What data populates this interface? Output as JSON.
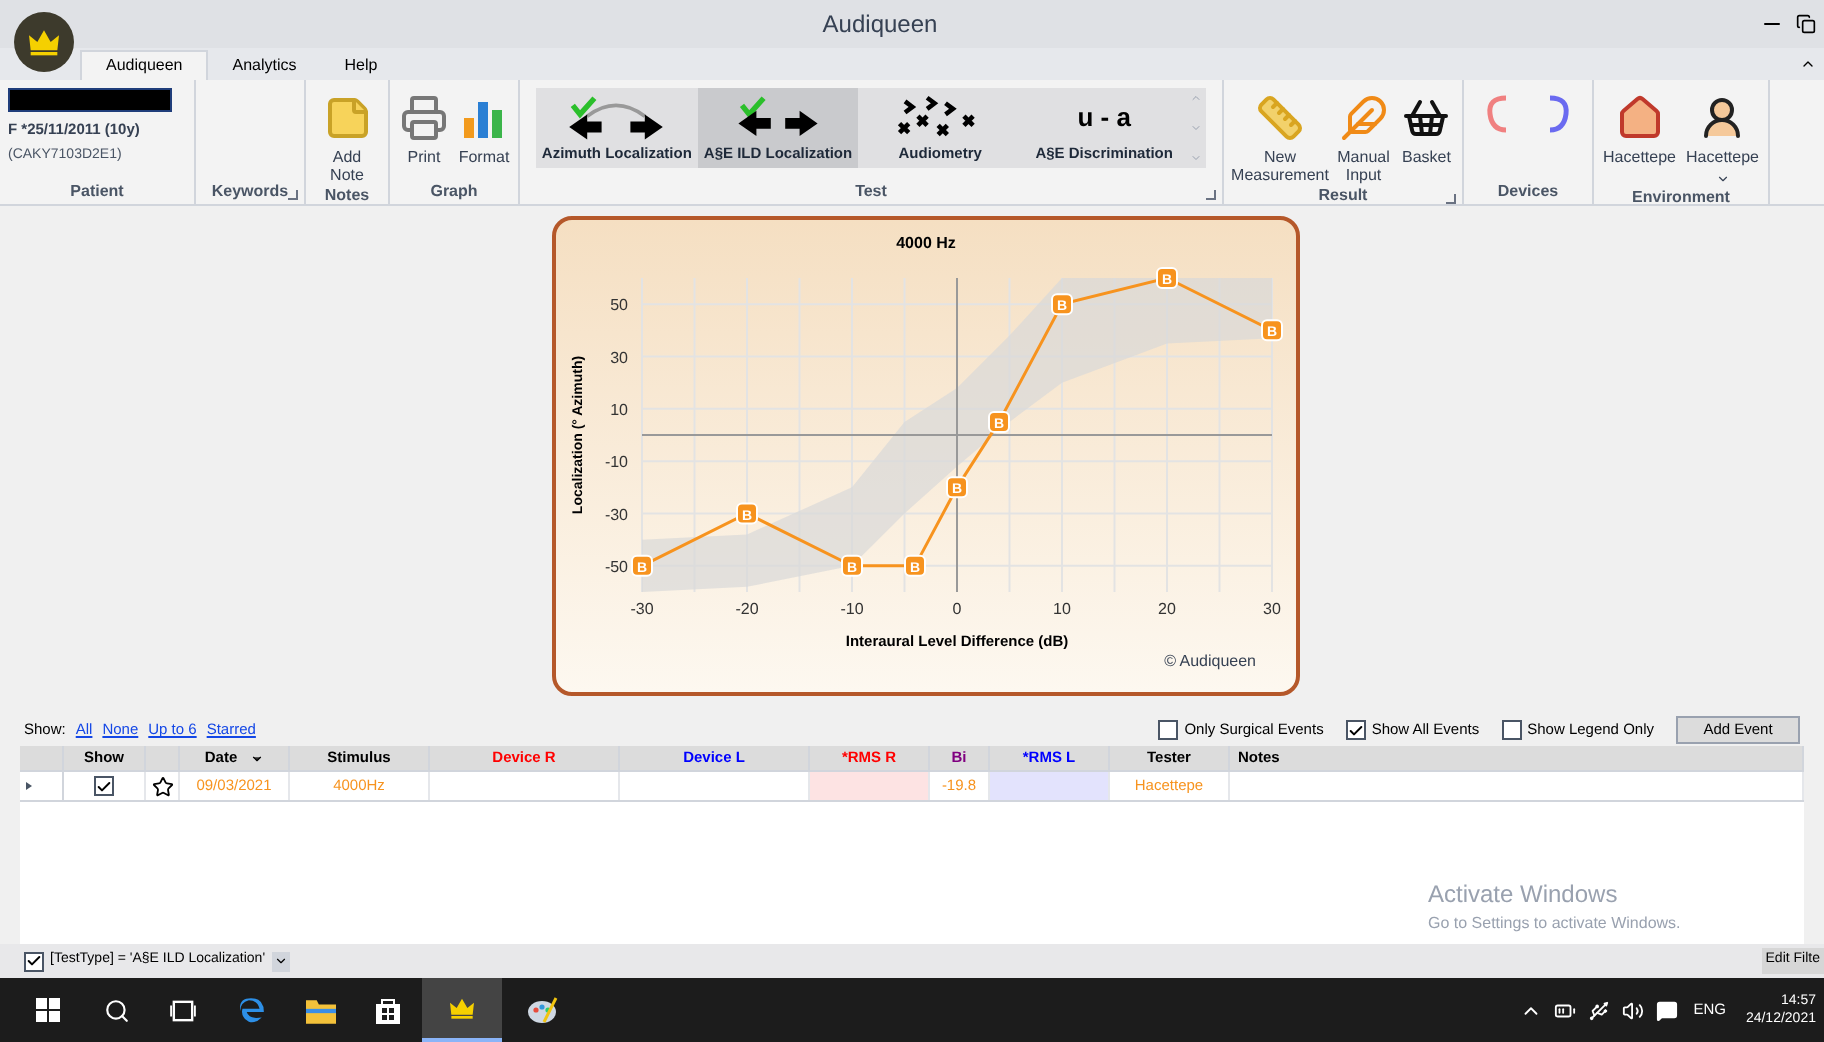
{
  "window": {
    "title": "Audiqueen"
  },
  "tabs": [
    {
      "label": "Audiqueen",
      "selected": true
    },
    {
      "label": "Analytics",
      "selected": false
    },
    {
      "label": "Help",
      "selected": false
    }
  ],
  "patient": {
    "birth": "F *25/11/2011 (10y)",
    "code": "(CAKY7103D2E1)"
  },
  "ribbon_groups": [
    {
      "label": "Patient",
      "launcher": false
    },
    {
      "label": "Keywords",
      "launcher": true
    },
    {
      "label": "Notes",
      "launcher": false
    },
    {
      "label": "Graph",
      "launcher": false
    },
    {
      "label": "Test",
      "launcher": true
    },
    {
      "label": "Result",
      "launcher": true
    },
    {
      "label": "Devices",
      "launcher": false
    },
    {
      "label": "Environment",
      "launcher": false
    }
  ],
  "notes_buttons": [
    {
      "label": "Add Note",
      "kind": "note"
    }
  ],
  "graph_buttons": [
    {
      "label": "Print",
      "kind": "print"
    },
    {
      "label": "Format",
      "kind": "format"
    }
  ],
  "tests": [
    {
      "label": "Azimuth Localization",
      "kind": "azimuth",
      "selected": false
    },
    {
      "label": "A§E ILD Localization",
      "kind": "ild",
      "selected": true
    },
    {
      "label": "Audiometry",
      "kind": "audiometry",
      "selected": false
    },
    {
      "label": "A§E Discrimination",
      "kind": "text",
      "glyph": "u - a",
      "selected": false
    }
  ],
  "result_buttons": [
    {
      "label": "New Measurement",
      "kind": "ruler"
    },
    {
      "label": "Manual Input",
      "kind": "feather"
    },
    {
      "label": "Basket",
      "kind": "basket"
    }
  ],
  "devices": [
    {
      "kind": "right"
    },
    {
      "kind": "left"
    }
  ],
  "environment": [
    {
      "label": "Hacettepe",
      "kind": "house",
      "dropdown": false
    },
    {
      "label": "Hacettepe",
      "kind": "person",
      "dropdown": true
    }
  ],
  "chart": {
    "chart_data": {
      "type": "line",
      "title": "4000 Hz",
      "xlabel": "Interaural Level Difference (dB)",
      "ylabel": "Localization (° Azimuth)",
      "x": [
        -30,
        -20,
        -10,
        -4,
        0,
        4,
        10,
        20,
        30
      ],
      "series": [
        {
          "name": "B",
          "color": "#f7931e",
          "marker": "square",
          "values": [
            -50,
            -30,
            -50,
            -50,
            -20,
            5,
            50,
            60,
            40
          ]
        }
      ],
      "grid": true,
      "xlim": [
        -30,
        30
      ],
      "ylim": [
        -60,
        60
      ],
      "xticks": [
        -30,
        -20,
        -10,
        0,
        10,
        20,
        30
      ],
      "yticks": [
        -50,
        -30,
        -10,
        10,
        30,
        50
      ]
    },
    "copyright": "© Audiqueen"
  },
  "show_links": {
    "label": "Show:",
    "links": [
      "All",
      "None",
      "Up to 6",
      "Starred"
    ]
  },
  "options": [
    {
      "label": "Only Surgical Events",
      "checked": false
    },
    {
      "label": "Show All Events",
      "checked": true
    },
    {
      "label": "Show Legend Only",
      "checked": false
    }
  ],
  "add_event": "Add Event",
  "table": {
    "columns": [
      {
        "label": "Show",
        "color": "#000000",
        "kind": "show"
      },
      {
        "kind": "star"
      },
      {
        "label": "Date",
        "color": "#000000",
        "kind": "date",
        "sorted": true
      },
      {
        "label": "Stimulus",
        "color": "#000000",
        "kind": "stimulus"
      },
      {
        "label": "Device R",
        "color": "#ff0000",
        "kind": "device_r"
      },
      {
        "label": "Device L",
        "color": "#0000ff",
        "kind": "device_l"
      },
      {
        "label": "*RMS R",
        "color": "#ff0000",
        "kind": "rms_r"
      },
      {
        "label": "Bi",
        "color": "#800080",
        "kind": "bi"
      },
      {
        "label": "*RMS  L",
        "color": "#0000ff",
        "kind": "rms_l"
      },
      {
        "label": "Tester",
        "color": "#000000",
        "kind": "tester"
      },
      {
        "label": "Notes",
        "color": "#000000",
        "kind": "notes"
      }
    ],
    "rows": [
      {
        "show": true,
        "starred": false,
        "date": "09/03/2021",
        "stimulus": "4000Hz",
        "bi": "-19.8",
        "tester": "Hacettepe"
      }
    ]
  },
  "filter": {
    "checked": true,
    "text": "[TestType] = 'A§E ILD Localization'"
  },
  "edit_filter": "Edit Filte",
  "activation": {
    "title": "Activate Windows",
    "subtitle": "Go to Settings to activate Windows."
  },
  "taskbar": {
    "lang": "ENG",
    "time": "14:57",
    "date": "24/12/2021"
  }
}
